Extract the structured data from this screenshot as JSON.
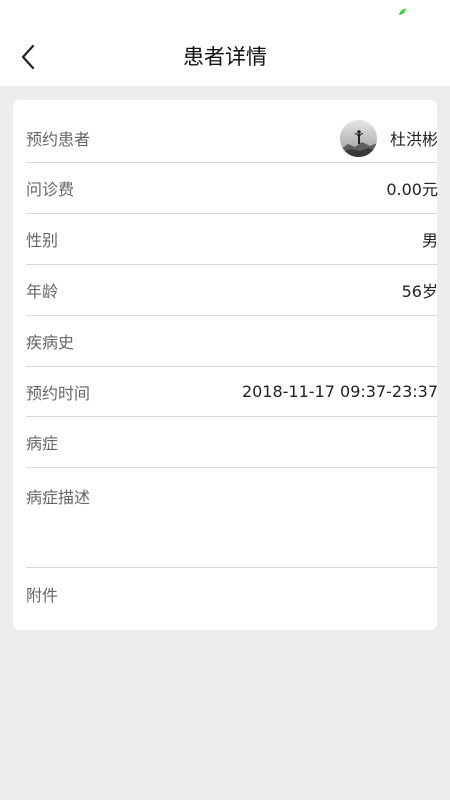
{
  "header": {
    "title": "患者详情"
  },
  "patient": {
    "label": "预约患者",
    "name": "杜洪彬"
  },
  "fields": {
    "fee": {
      "label": "问诊费",
      "value": "0.00元"
    },
    "gender": {
      "label": "性别",
      "value": "男"
    },
    "age": {
      "label": "年龄",
      "value": "56岁"
    },
    "history": {
      "label": "疾病史",
      "value": ""
    },
    "appointment_time": {
      "label": "预约时间",
      "value": "2018-11-17 09:37-23:37"
    },
    "symptom": {
      "label": "病症",
      "value": ""
    },
    "symptom_desc": {
      "label": "病症描述",
      "value": ""
    },
    "attachment": {
      "label": "附件",
      "value": ""
    }
  },
  "colors": {
    "status_icon": "#3ecf3e",
    "background": "#ededed",
    "card": "#ffffff"
  }
}
